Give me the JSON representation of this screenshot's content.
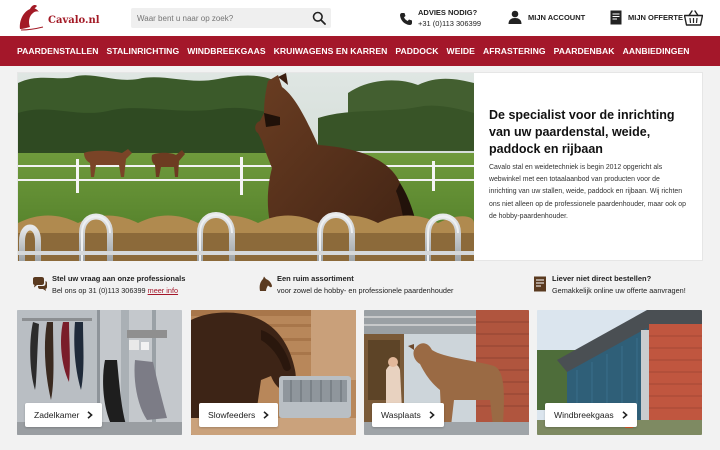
{
  "header": {
    "logo_text": "Cavalo.nl",
    "search_placeholder": "Waar bent u naar op zoek?",
    "help_title": "ADVIES NODIG?",
    "help_phone": "+31 (0)113 306399",
    "account_label": "MIJN ACCOUNT",
    "quote_label": "MIJN OFFERTE",
    "icons": [
      "search-icon",
      "phone-icon",
      "user-icon",
      "document-icon",
      "basket-icon"
    ]
  },
  "nav": {
    "items": [
      "PAARDENSTALLEN",
      "STALINRICHTING",
      "WINDBREEKGAAS",
      "KRUIWAGENS EN KARREN",
      "PADDOCK",
      "WEIDE",
      "AFRASTERING",
      "PAARDENBAK",
      "AANBIEDINGEN"
    ]
  },
  "hero": {
    "title": "De specialist voor de inrichting van uw paardenstal, weide, paddock en rijbaan",
    "body": "Cavalo stal en weidetechniek is begin 2012 opgericht als webwinkel met een totaalaanbod van producten voor de inrichting van uw stallen, weide, paddock en rijbaan. Wij richten ons niet alleen op de professionele paardenhouder, maar ook op de hobby-paardenhouder."
  },
  "usps": [
    {
      "title": "Stel uw vraag aan onze professionals",
      "text": "Bel ons op 31 (0)113 306399 ",
      "link": "meer info",
      "icon": "chat-icon"
    },
    {
      "title": "Een ruim assortiment",
      "text": "voor zowel de hobby- en professionele paardenhouder",
      "icon": "horse-head-icon"
    },
    {
      "title": "Liever niet direct bestellen?",
      "text": "Gemakkelijk online uw offerte aanvragen!",
      "icon": "document-icon"
    }
  ],
  "tiles": [
    {
      "label": "Zadelkamer"
    },
    {
      "label": "Slowfeeders"
    },
    {
      "label": "Wasplaats"
    },
    {
      "label": "Windbreekgaas"
    }
  ],
  "colors": {
    "brand_red": "#a4172a",
    "page_bg": "#f2f2f2"
  }
}
